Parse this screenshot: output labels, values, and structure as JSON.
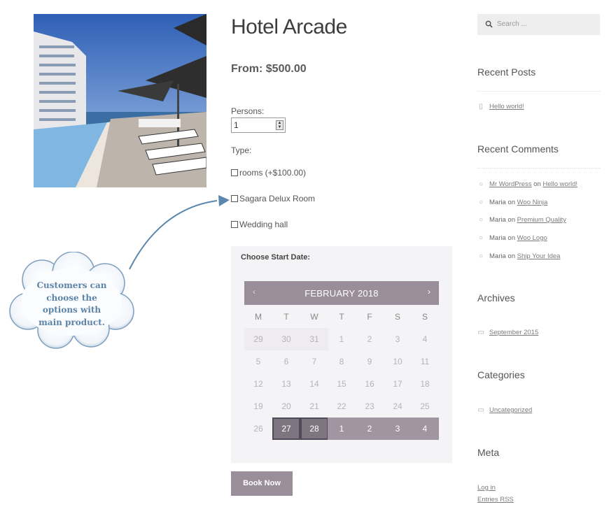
{
  "product": {
    "title": "Hotel Arcade",
    "price": "From: $500.00",
    "persons_label": "Persons:",
    "persons_value": "1",
    "type_label": "Type:",
    "options": [
      "rooms (+$100.00)",
      "Sagara Delux Room",
      "Wedding hall"
    ],
    "book_button": "Book Now"
  },
  "calendar": {
    "legend": "Choose Start Date:",
    "month": "FEBRUARY 2018",
    "prev": "‹",
    "next": "›",
    "weekdays": [
      "M",
      "T",
      "W",
      "T",
      "F",
      "S",
      "S"
    ],
    "weeks": [
      [
        "29",
        "30",
        "31",
        "1",
        "2",
        "3",
        "4"
      ],
      [
        "5",
        "6",
        "7",
        "8",
        "9",
        "10",
        "11"
      ],
      [
        "12",
        "13",
        "14",
        "15",
        "16",
        "17",
        "18"
      ],
      [
        "19",
        "20",
        "21",
        "22",
        "23",
        "24",
        "25"
      ],
      [
        "26",
        "27",
        "28",
        "1",
        "2",
        "3",
        "4"
      ]
    ]
  },
  "sidebar": {
    "search_placeholder": "Search ...",
    "recent_posts_title": "Recent Posts",
    "recent_posts": [
      "Hello world!"
    ],
    "recent_comments_title": "Recent Comments",
    "comments": [
      {
        "author": "Mr WordPress",
        "on": "on",
        "post": "Hello world!"
      },
      {
        "author": "Maria",
        "on": "on",
        "post": "Woo Ninja"
      },
      {
        "author": "Maria",
        "on": "on",
        "post": "Premium Quality"
      },
      {
        "author": "Maria",
        "on": "on",
        "post": "Woo Logo"
      },
      {
        "author": "Maria",
        "on": "on",
        "post": "Ship Your Idea"
      }
    ],
    "archives_title": "Archives",
    "archives": [
      "September 2015"
    ],
    "categories_title": "Categories",
    "categories": [
      "Uncategorized"
    ],
    "meta_title": "Meta",
    "meta": [
      "Log in",
      "Entries RSS"
    ]
  },
  "callout": {
    "lines": [
      "Customers can",
      "choose the",
      "options with",
      "main product."
    ]
  },
  "colors": {
    "accent": "#9b8e9b",
    "callout_text": "#5c83a8"
  }
}
